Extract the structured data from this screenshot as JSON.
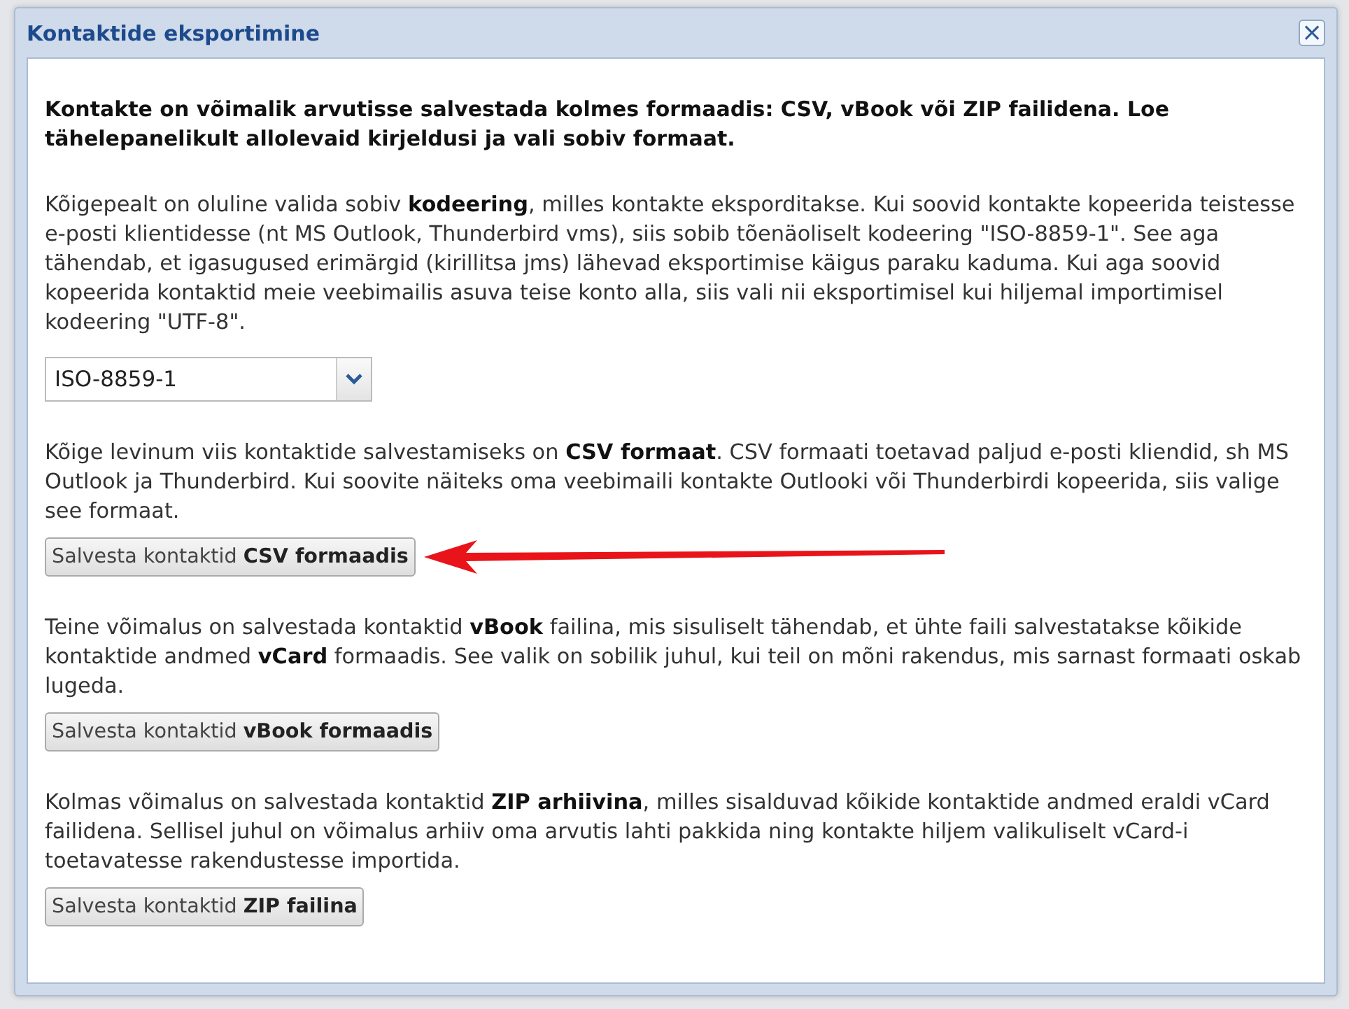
{
  "dialog": {
    "title": "Kontaktide eksportimine",
    "close_icon": "×"
  },
  "intro": "Kontakte on võimalik arvutisse salvestada kolmes formaadis: CSV, vBook või ZIP failidena. Loe tähelepanelikult allolevaid kirjeldusi ja vali sobiv formaat.",
  "sections": [
    {
      "kind": "select",
      "text": "Kõigepealt on oluline valida sobiv **kodeering**, milles kontakte eksporditakse. Kui soovid kontakte kopeerida teistesse e-posti klientidesse (nt MS Outlook, Thunderbird vms), siis sobib tõenäoliselt kodeering \"ISO-8859-1\". See aga tähendab, et igasugused erimärgid (kirillitsa jms) lähevad eksportimise käigus paraku kaduma. Kui aga soovid kopeerida kontaktid meie veebimailis asuva teise konto alla, siis vali nii eksportimisel kui hiljemal importimisel kodeering \"UTF-8\".",
      "value": "ISO-8859-1",
      "arrow": false
    },
    {
      "kind": "button",
      "text": "Kõige levinum viis kontaktide salvestamiseks on **CSV formaat**. CSV formaati toetavad paljud e-posti kliendid, sh MS Outlook ja Thunderbird. Kui soovite näiteks oma veebimaili kontakte Outlooki või Thunderbirdi kopeerida, siis valige see formaat.",
      "button": "Salvesta kontaktid **CSV formaadis**",
      "arrow": true
    },
    {
      "kind": "button",
      "text": "Teine võimalus on salvestada kontaktid **vBook** failina, mis sisuliselt tähendab, et ühte faili salvestatakse kõikide kontaktide andmed **vCard** formaadis. See valik on sobilik juhul, kui teil on mõni rakendus, mis sarnast formaati oskab lugeda.",
      "button": "Salvesta kontaktid **vBook formaadis**",
      "arrow": false
    },
    {
      "kind": "button",
      "text": "Kolmas võimalus on salvestada kontaktid **ZIP arhiivina**, milles sisalduvad kõikide kontaktide andmed eraldi vCard failidena. Sellisel juhul on võimalus arhiiv oma arvutis lahti pakkida ning kontakte hiljem valikuliselt vCard-i toetavatesse rakendustesse importida.",
      "button": "Salvesta kontaktid **ZIP failina**",
      "arrow": false
    }
  ]
}
